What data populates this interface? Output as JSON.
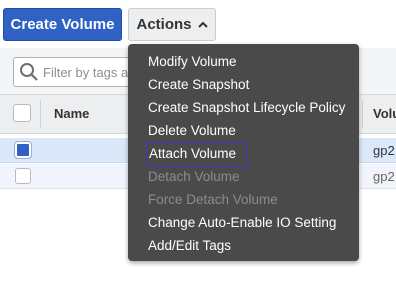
{
  "toolbar": {
    "create_volume_label": "Create Volume",
    "actions_label": "Actions"
  },
  "filter": {
    "search_placeholder": "Filter by tags a"
  },
  "table": {
    "columns": [
      "Name",
      "Volu"
    ],
    "rows": [
      {
        "selected": true,
        "volume_type": "gp2"
      },
      {
        "selected": false,
        "volume_type": "gp2"
      }
    ]
  },
  "actions_menu": {
    "items": [
      {
        "label": "Modify Volume",
        "enabled": true
      },
      {
        "label": "Create Snapshot",
        "enabled": true
      },
      {
        "label": "Create Snapshot Lifecycle Policy",
        "enabled": true
      },
      {
        "label": "Delete Volume",
        "enabled": true
      },
      {
        "label": "Attach Volume",
        "enabled": true,
        "focused": true
      },
      {
        "label": "Detach Volume",
        "enabled": false
      },
      {
        "label": "Force Detach Volume",
        "enabled": false
      },
      {
        "label": "Change Auto-Enable IO Setting",
        "enabled": true
      },
      {
        "label": "Add/Edit Tags",
        "enabled": true
      }
    ]
  },
  "colors": {
    "primary_button": "#2f62c4",
    "menu_background": "#4a4a4a",
    "selected_row": "#dbe8f9",
    "focus_outline": "#3b36c9"
  }
}
